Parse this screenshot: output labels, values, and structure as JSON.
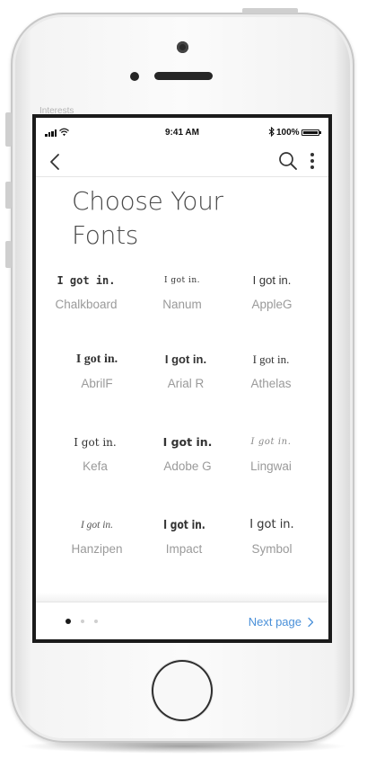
{
  "background_label": "Interests",
  "status_bar": {
    "time": "9:41 AM",
    "battery_percent": "100%",
    "battery_level": 1.0,
    "icons": [
      "signal-icon",
      "wifi-icon",
      "bluetooth-icon",
      "battery-icon"
    ]
  },
  "nav": {
    "back_icon": "chevron-left-icon",
    "search_icon": "search-icon",
    "more_icon": "more-vertical-icon"
  },
  "title_lines": [
    "Choose Your",
    "Fonts"
  ],
  "fonts": [
    {
      "sample": "I got in.",
      "name": "Chalkboard"
    },
    {
      "sample": "I got in.",
      "name": "Nanum"
    },
    {
      "sample": "I got in.",
      "name": "AppleG"
    },
    {
      "sample": "I got in.",
      "name": "AbrilF"
    },
    {
      "sample": "I got in.",
      "name": "Arial R"
    },
    {
      "sample": "I got in.",
      "name": "Athelas"
    },
    {
      "sample": "I got in.",
      "name": "Kefa"
    },
    {
      "sample": "I got in.",
      "name": "Adobe G"
    },
    {
      "sample": "I got in.",
      "name": "Lingwai"
    },
    {
      "sample": "I got in.",
      "name": "Hanzipen"
    },
    {
      "sample": "I got in.",
      "name": "Impact"
    },
    {
      "sample": "I got in.",
      "name": "Symbol"
    }
  ],
  "footer": {
    "page_count": 3,
    "current_page": 1,
    "next_label": "Next page",
    "next_icon": "chevron-right-icon"
  },
  "colors": {
    "link": "#4a90d9",
    "title": "#4a4a4a",
    "font_name": "#9a9a9a"
  }
}
